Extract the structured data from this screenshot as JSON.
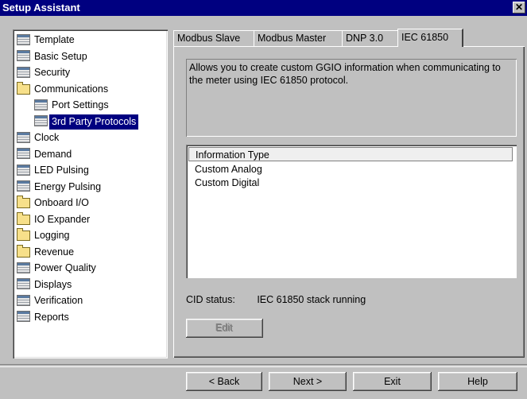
{
  "window": {
    "title": "Setup Assistant",
    "close_glyph": "✕"
  },
  "tree": {
    "items": [
      {
        "label": "Template",
        "icon": "page-icon",
        "indent": 0
      },
      {
        "label": "Basic Setup",
        "icon": "page-icon",
        "indent": 0
      },
      {
        "label": "Security",
        "icon": "page-icon",
        "indent": 0
      },
      {
        "label": "Communications",
        "icon": "folder-icon",
        "indent": 0
      },
      {
        "label": "Port Settings",
        "icon": "page-icon",
        "indent": 1
      },
      {
        "label": "3rd Party Protocols",
        "icon": "page-icon",
        "indent": 1,
        "selected": true
      },
      {
        "label": "Clock",
        "icon": "page-icon",
        "indent": 0
      },
      {
        "label": "Demand",
        "icon": "page-icon",
        "indent": 0
      },
      {
        "label": "LED Pulsing",
        "icon": "page-icon",
        "indent": 0
      },
      {
        "label": "Energy Pulsing",
        "icon": "page-icon",
        "indent": 0
      },
      {
        "label": "Onboard I/O",
        "icon": "folder-icon",
        "indent": 0
      },
      {
        "label": "IO Expander",
        "icon": "folder-icon",
        "indent": 0
      },
      {
        "label": "Logging",
        "icon": "folder-icon",
        "indent": 0
      },
      {
        "label": "Revenue",
        "icon": "folder-icon",
        "indent": 0
      },
      {
        "label": "Power Quality",
        "icon": "page-icon",
        "indent": 0
      },
      {
        "label": "Displays",
        "icon": "page-icon",
        "indent": 0
      },
      {
        "label": "Verification",
        "icon": "page-icon",
        "indent": 0
      },
      {
        "label": "Reports",
        "icon": "page-icon",
        "indent": 0
      }
    ]
  },
  "tabs": {
    "modbus_slave": "Modbus Slave",
    "modbus_master": "Modbus Master",
    "dnp": "DNP 3.0",
    "iec": "IEC 61850",
    "active": "IEC 61850"
  },
  "description": "Allows you to create custom GGIO information when communicating to the meter using IEC 61850 protocol.",
  "info_list": {
    "header": "Information Type",
    "rows": [
      "Custom Analog",
      "Custom Digital"
    ]
  },
  "cid": {
    "label": "CID status:",
    "value": "IEC 61850 stack running"
  },
  "buttons": {
    "edit": "Edit",
    "back": "< Back",
    "next": "Next >",
    "exit": "Exit",
    "help": "Help"
  }
}
